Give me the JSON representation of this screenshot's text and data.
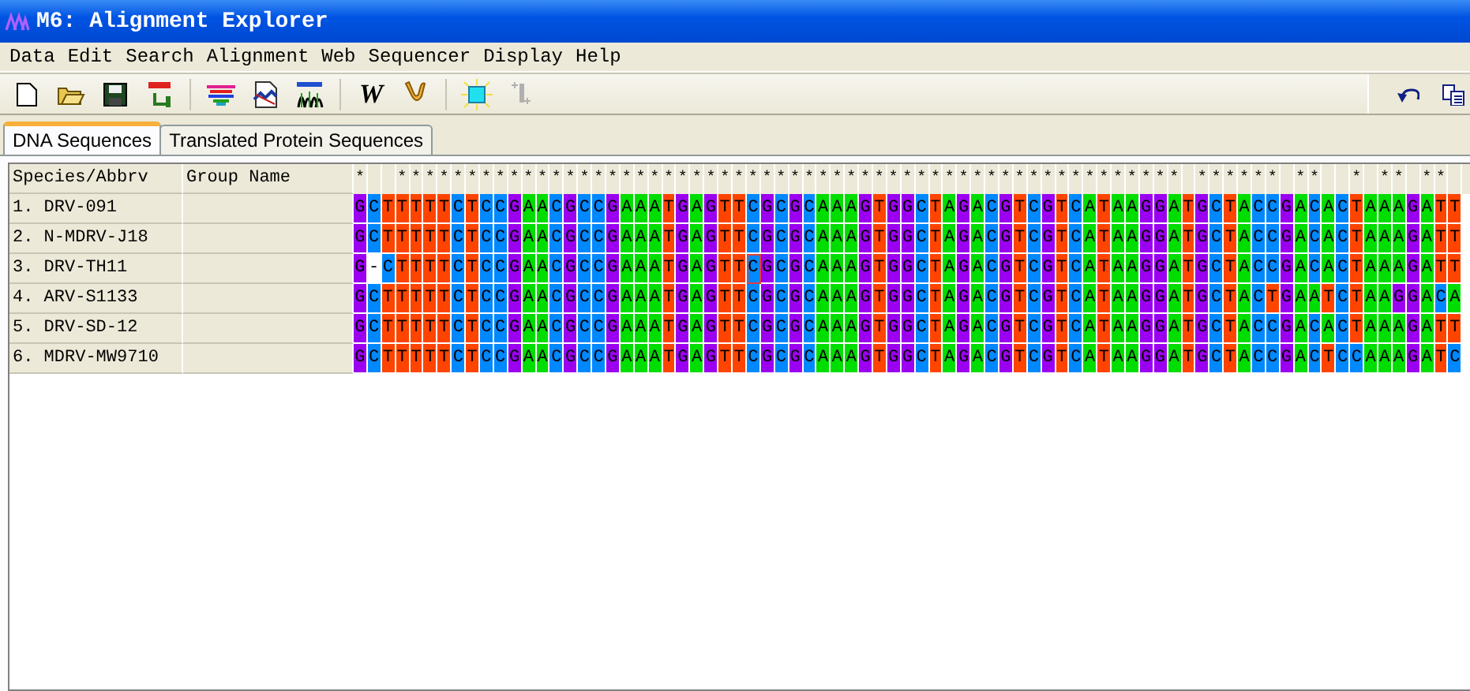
{
  "window": {
    "title": "M6: Alignment Explorer"
  },
  "menu": [
    "Data",
    "Edit",
    "Search",
    "Alignment",
    "Web",
    "Sequencer",
    "Display",
    "Help"
  ],
  "toolbar": [
    {
      "kind": "new"
    },
    {
      "kind": "open"
    },
    {
      "kind": "save"
    },
    {
      "kind": "translate"
    },
    {
      "kind": "sep"
    },
    {
      "kind": "align"
    },
    {
      "kind": "web"
    },
    {
      "kind": "trace"
    },
    {
      "kind": "sep"
    },
    {
      "kind": "text",
      "label": "W"
    },
    {
      "kind": "muscle"
    },
    {
      "kind": "sep"
    },
    {
      "kind": "mark"
    },
    {
      "kind": "pair",
      "disabled": true
    }
  ],
  "toolbar_right": [
    {
      "kind": "undo"
    },
    {
      "kind": "copy"
    }
  ],
  "tabs": [
    {
      "label": "DNA Sequences",
      "selected": true
    },
    {
      "label": "Translated Protein Sequences",
      "selected": false
    }
  ],
  "columns": [
    "Species/Abbrv",
    "Group Name"
  ],
  "consensus": "*  ******************************************************** ****** **  * ** **  ",
  "rows": [
    {
      "name": "1. DRV-091",
      "segments": [
        {
          "bases": "GCTTTTTCTCCGAACGCCGAAATGAGTTCGCGCAAAGTGGCTAGACGTCGTCATAAGGATGCTACCGACACTAAAGATT",
          "selected": false
        }
      ]
    },
    {
      "name": "2. N-MDRV-J18",
      "segments": [
        {
          "bases": "GCTTTTTCTCCGAACGCCGAAATGAGTTCGCGCAAAGTGGCTAGACGTCGTCATAAGGATGCTACCGACACTAAAGATT",
          "selected": false
        }
      ]
    },
    {
      "name": "3. DRV-TH11",
      "segments": [
        {
          "bases": "G-CTTTTCTCCGAACGCCGAAATGAGTT",
          "selected": false
        },
        {
          "bases": "C",
          "selected": true
        },
        {
          "bases": "GCGCAAAGTGGCTAGACGTCGTCATAAGGATGCTACCGACACTAAAGATT",
          "selected": false
        }
      ]
    },
    {
      "name": "4. ARV-S1133",
      "segments": [
        {
          "bases": "GCTTTTTCTCCGAACGCCGAAATGAGTTCGCGCAAAGTGGCTAGACGTCGTCATAAGGATGCTACTGAATCTAAGGACA",
          "selected": false
        }
      ]
    },
    {
      "name": "5. DRV-SD-12",
      "segments": [
        {
          "bases": "GCTTTTTCTCCGAACGCCGAAATGAGTTCGCGCAAAGTGGCTAGACGTCGTCATAAGGATGCTACCGACACTAAAGATT",
          "selected": false
        }
      ]
    },
    {
      "name": "6. MDRV-MW9710",
      "segments": [
        {
          "bases": "GCTTTTTCTCCGAACGCCGAAATGAGTTCGCGCAAAGTGGCTAGACGTCGTCATAAGGATGCTACCGACTCCAAAGATC",
          "selected": false
        }
      ]
    }
  ]
}
